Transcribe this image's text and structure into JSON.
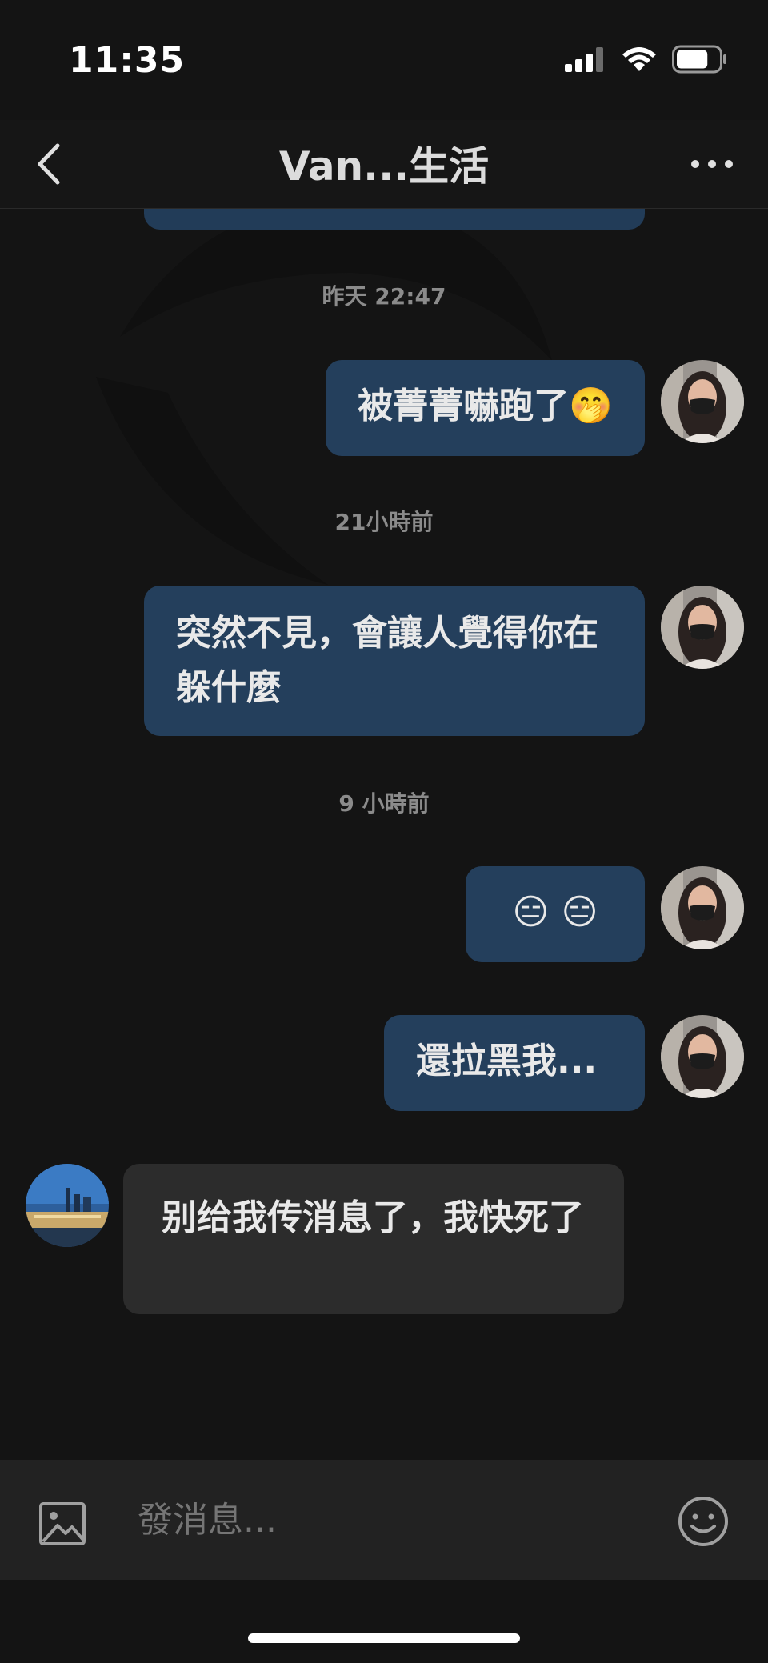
{
  "status_bar": {
    "time": "11:35",
    "battery_level": 0.75
  },
  "header": {
    "title": "Van...生活"
  },
  "messages": [
    {
      "type": "timestamp",
      "text": "昨天 22:47"
    },
    {
      "type": "outgoing",
      "text": "被菁菁嚇跑了",
      "emoji": "🤭"
    },
    {
      "type": "timestamp",
      "text": "21小時前"
    },
    {
      "type": "outgoing",
      "text": "突然不見，會讓人覺得你在躲什麼"
    },
    {
      "type": "timestamp",
      "text": "9 小時前"
    },
    {
      "type": "outgoing",
      "text": "😑 😑"
    },
    {
      "type": "outgoing",
      "text": "還拉黑我..."
    },
    {
      "type": "incoming",
      "text": "别给我传消息了，我快死了"
    }
  ],
  "composer": {
    "placeholder": "發消息..."
  },
  "icons": {
    "back": "chevron-left-icon",
    "more": "more-dots-icon",
    "image": "image-icon",
    "emoji": "smiley-icon",
    "signal": "signal-icon",
    "wifi": "wifi-icon",
    "battery": "battery-icon"
  },
  "colors": {
    "background": "#141414",
    "outgoing_bubble": "#243f5c",
    "incoming_bubble": "#2c2c2c",
    "timestamp": "#8b8b8b"
  }
}
